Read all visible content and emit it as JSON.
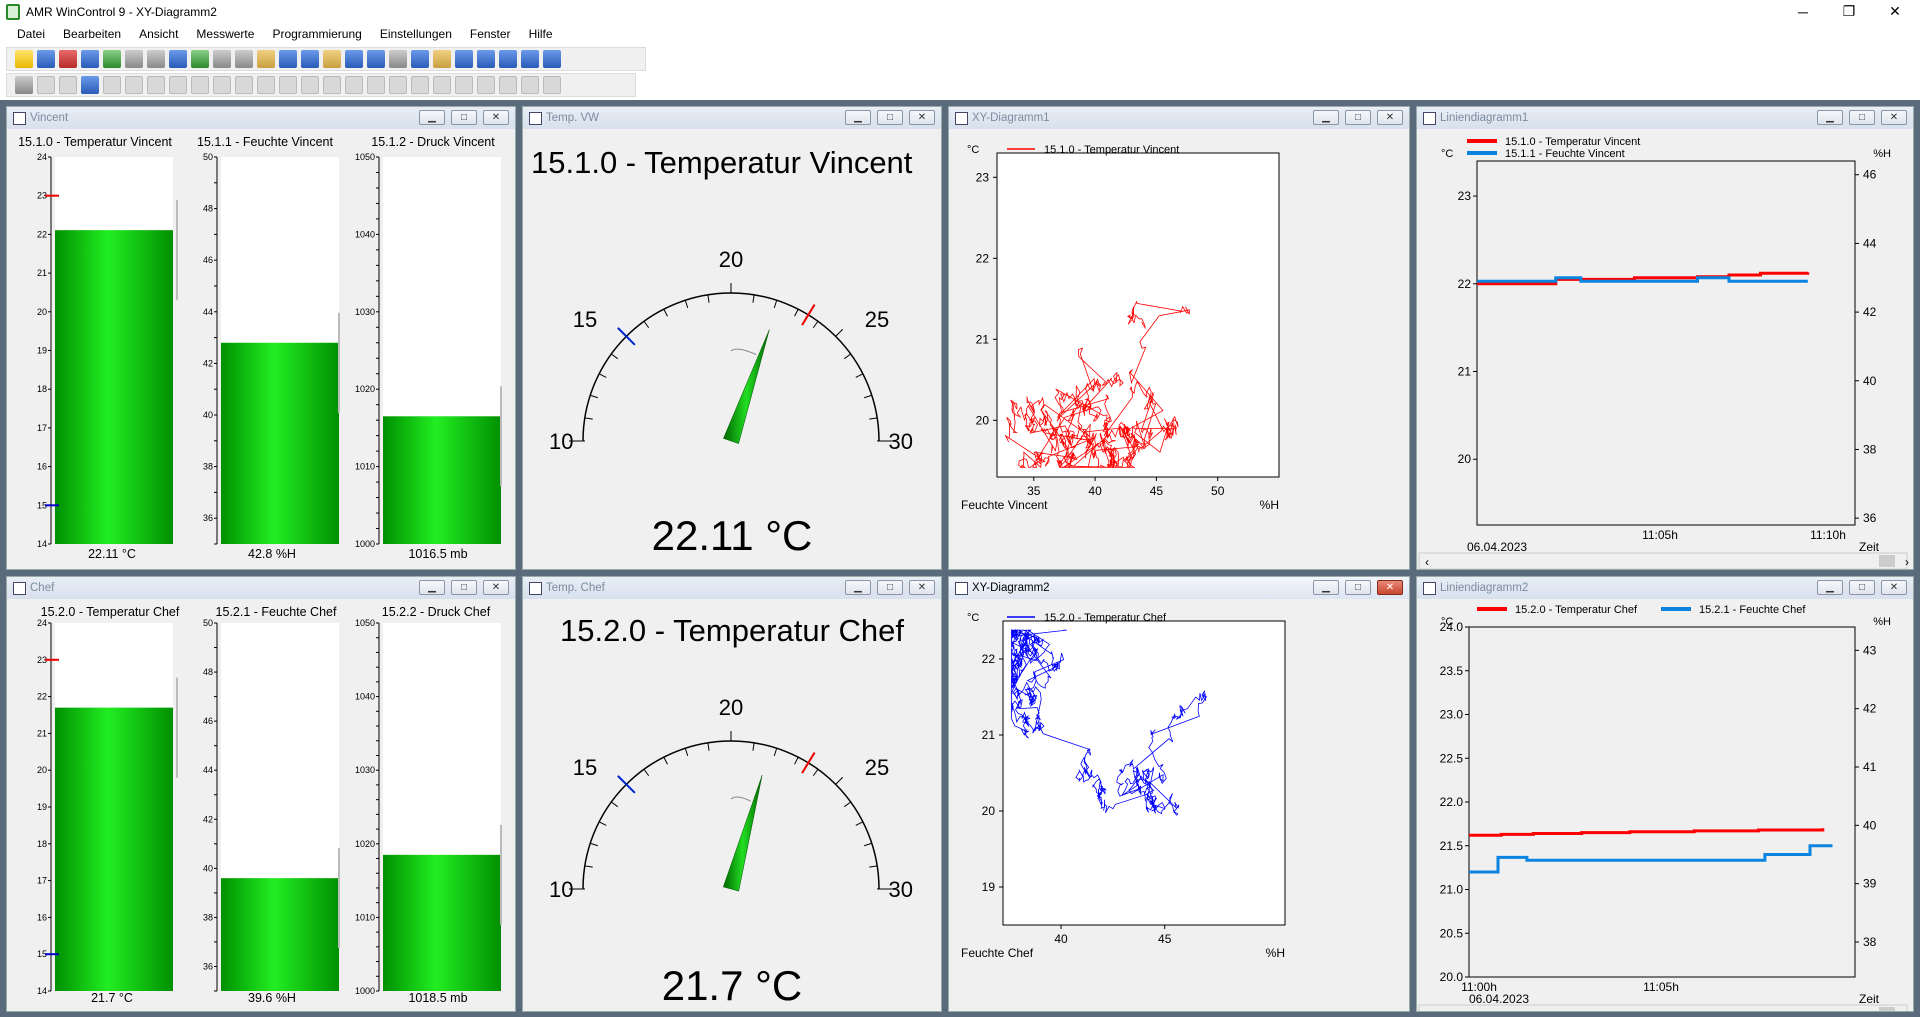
{
  "app": {
    "title": "AMR WinControl 9 - XY-Diagramm2"
  },
  "menu": [
    "Datei",
    "Bearbeiten",
    "Ansicht",
    "Messwerte",
    "Programmierung",
    "Einstellungen",
    "Fenster",
    "Hilfe"
  ],
  "windows": {
    "vincent": {
      "title": "Vincent"
    },
    "temp_vw": {
      "title": "Temp. VW"
    },
    "xy1": {
      "title": "XY-Diagramm1"
    },
    "line1": {
      "title": "Liniendiagramm1"
    },
    "chef": {
      "title": "Chef"
    },
    "temp_chef": {
      "title": "Temp. Chef"
    },
    "xy2": {
      "title": "XY-Diagramm2"
    },
    "line2": {
      "title": "Liniendiagramm2"
    }
  },
  "bars_vincent": [
    {
      "name": "15.1.0 - Temperatur Vincent",
      "value_label": "22.11 °C",
      "value": 22.11,
      "min": 14,
      "max": 24,
      "ticks": [
        "24",
        "23",
        "22",
        "21",
        "20",
        "19",
        "18",
        "17",
        "16",
        "15",
        "14"
      ]
    },
    {
      "name": "15.1.1 - Feuchte Vincent",
      "value_label": "42.8 %H",
      "value": 42.8,
      "min": 35,
      "max": 50,
      "ticks": [
        "50",
        "48",
        "46",
        "44",
        "42",
        "40",
        "38",
        "36"
      ]
    },
    {
      "name": "15.1.2 - Druck Vincent",
      "value_label": "1016.5 mb",
      "value": 1016.5,
      "min": 1000,
      "max": 1050,
      "ticks": [
        "1050",
        "1040",
        "1030",
        "1020",
        "1010",
        "1000"
      ]
    }
  ],
  "bars_chef": [
    {
      "name": "15.2.0 - Temperatur Chef",
      "value_label": "21.7 °C",
      "value": 21.7,
      "min": 14,
      "max": 24,
      "ticks": [
        "24",
        "23",
        "22",
        "21",
        "20",
        "19",
        "18",
        "17",
        "16",
        "15",
        "14"
      ]
    },
    {
      "name": "15.2.1 - Feuchte Chef",
      "value_label": "39.6 %H",
      "value": 39.6,
      "min": 35,
      "max": 50,
      "ticks": [
        "50",
        "48",
        "46",
        "44",
        "42",
        "40",
        "38",
        "36"
      ]
    },
    {
      "name": "15.2.2 - Druck Chef",
      "value_label": "1018.5 mb",
      "value": 1018.5,
      "min": 1000,
      "max": 1050,
      "ticks": [
        "1050",
        "1040",
        "1030",
        "1020",
        "1010",
        "1000"
      ]
    }
  ],
  "gauge_vw": {
    "title": "15.1.0 - Temperatur Vincent",
    "value_label": "22.11 °C",
    "value": 22.11,
    "min": 10,
    "max": 30,
    "labels": [
      "10",
      "15",
      "20",
      "25",
      "30"
    ],
    "low_mark": 15,
    "high_mark": 23.5
  },
  "gauge_chef": {
    "title": "15.2.0 - Temperatur Chef",
    "value_label": "21.7 °C",
    "value": 21.7,
    "min": 10,
    "max": 30,
    "labels": [
      "10",
      "15",
      "20",
      "25",
      "30"
    ],
    "low_mark": 15,
    "high_mark": 23.5
  },
  "chart_data": [
    {
      "type": "scatter",
      "title": "",
      "series": [
        {
          "name": "15.1.0 - Temperatur Vincent",
          "color": "#ff0000"
        }
      ],
      "ylabel": "°C",
      "xlabel": "Feuchte Vincent",
      "xunit": "%H",
      "xlim": [
        32,
        55
      ],
      "ylim": [
        19.3,
        23.3
      ],
      "xticks": [
        "35",
        "40",
        "45",
        "50"
      ],
      "yticks": [
        "23",
        "22",
        "21",
        "20"
      ]
    },
    {
      "type": "line",
      "title": "",
      "series": [
        {
          "name": "15.1.0 - Temperatur Vincent",
          "color": "#ff0000",
          "x": [
            0,
            1.5,
            2.5,
            4,
            5,
            6,
            7,
            8,
            9,
            10.5
          ],
          "values": [
            22.0,
            22.0,
            22.05,
            22.05,
            22.07,
            22.07,
            22.08,
            22.1,
            22.12,
            22.13
          ]
        },
        {
          "name": "15.1.1 - Feuchte Vincent",
          "color": "#0a84e0",
          "x": [
            0,
            1.5,
            2.5,
            3.3,
            4,
            6,
            7,
            8,
            9,
            10.5
          ],
          "values": [
            42.9,
            42.9,
            43.0,
            42.9,
            42.9,
            42.9,
            43.0,
            42.9,
            42.9,
            42.9
          ]
        }
      ],
      "ylabel_left": "°C",
      "ylabel_right": "%H",
      "xlabel": "Zeit",
      "date": "06.04.2023",
      "xticks": [
        "11:05h",
        "11:10h"
      ],
      "yticks_left": [
        "23",
        "22",
        "21",
        "20"
      ],
      "yticks_right": [
        "46",
        "44",
        "42",
        "40",
        "38",
        "36"
      ],
      "ylim_left": [
        19.25,
        23.4
      ],
      "ylim_right": [
        35.8,
        46.4
      ]
    },
    {
      "type": "scatter",
      "title": "",
      "series": [
        {
          "name": "15.2.0 - Temperatur Chef",
          "color": "#0000ff"
        }
      ],
      "ylabel": "°C",
      "xlabel": "Feuchte Chef",
      "xunit": "%H",
      "xlim": [
        37.2,
        50.8
      ],
      "ylim": [
        18.5,
        22.5
      ],
      "xticks": [
        "40",
        "45"
      ],
      "yticks": [
        "22",
        "21",
        "20",
        "19"
      ]
    },
    {
      "type": "line",
      "title": "",
      "series": [
        {
          "name": "15.2.0 - Temperatur Chef",
          "color": "#ff0000",
          "x": [
            0,
            1,
            2,
            3.5,
            5,
            7,
            9,
            11
          ],
          "values": [
            21.62,
            21.63,
            21.64,
            21.65,
            21.66,
            21.67,
            21.68,
            21.7
          ]
        },
        {
          "name": "15.2.1 - Feuchte Chef",
          "color": "#0a84e0",
          "x": [
            0,
            0.6,
            0.9,
            1.5,
            1.8,
            8.8,
            9.2,
            10.3,
            10.6,
            11.3
          ],
          "values": [
            39.2,
            39.2,
            39.45,
            39.45,
            39.4,
            39.4,
            39.5,
            39.5,
            39.65,
            39.65
          ]
        }
      ],
      "ylabel_left": "°C",
      "ylabel_right": "%H",
      "xlabel": "Zeit",
      "date": "06.04.2023",
      "xticks": [
        "11:00h",
        "11:05h"
      ],
      "yticks_left": [
        "24.0",
        "23.5",
        "23.0",
        "22.5",
        "22.0",
        "21.5",
        "21.0",
        "20.5",
        "20.0"
      ],
      "yticks_right": [
        "43",
        "42",
        "41",
        "40",
        "39",
        "38"
      ],
      "ylim_left": [
        20.0,
        24.0
      ],
      "ylim_right": [
        37.4,
        43.4
      ]
    }
  ]
}
